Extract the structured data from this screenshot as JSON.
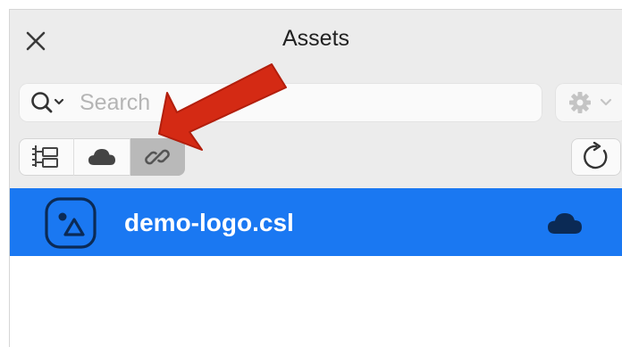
{
  "panel": {
    "title": "Assets",
    "search": {
      "placeholder": "Search",
      "value": ""
    },
    "tabs": [
      {
        "name": "tab-library",
        "icon": "library-tree-icon",
        "active": false
      },
      {
        "name": "tab-cloud",
        "icon": "cloud-icon",
        "active": false
      },
      {
        "name": "tab-linked",
        "icon": "link-icon",
        "active": true
      }
    ],
    "assets": [
      {
        "name": "demo-logo.csl",
        "icon": "shapes-symbol-icon",
        "status_icon": "cloud-icon",
        "selected": true
      }
    ]
  },
  "colors": {
    "selection": "#1a78f2",
    "annotation_arrow": "#d42a14",
    "panel_bg": "#ececec"
  }
}
